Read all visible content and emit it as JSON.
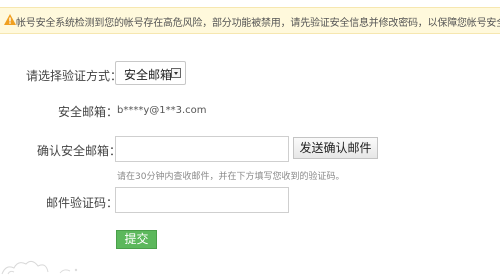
{
  "alert": {
    "icon": "warning-icon",
    "text": "帐号安全系统检测到您的帐号存在高危风险，部分功能被禁用，请先验证安全信息并修改密码，以保障您帐号安全！"
  },
  "form": {
    "method_label": "请选择验证方式：",
    "method_value": "安全邮箱",
    "email_label": "安全邮箱：",
    "email_value": "b****y@1**3.com",
    "confirm_label": "确认安全邮箱：",
    "confirm_value": "",
    "send_button": "发送确认邮件",
    "hint": "请在30分钟内查收邮件，并在下方填写您收到的验证码。",
    "code_label": "邮件验证码：",
    "code_value": "",
    "submit_button": "提交"
  },
  "colors": {
    "alert_bg": "#fff9dc",
    "submit_green": "#5cb85c"
  }
}
